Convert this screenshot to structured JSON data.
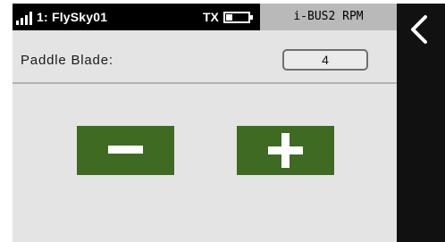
{
  "status_bar": {
    "model_name": "1: FlySky01",
    "tx_label": "TX",
    "signal_icon": "signal-strength-icon",
    "battery_icon": "battery-icon",
    "battery_level": 0.3
  },
  "header": {
    "title": "i-BUS2 RPM"
  },
  "parameter": {
    "label": "Paddle Blade:",
    "value": "4"
  },
  "controls": {
    "decrease_icon": "minus-icon",
    "increase_icon": "plus-icon"
  },
  "navigation": {
    "back_icon": "chevron-left-icon"
  },
  "colors": {
    "button_green": "#3f6a22",
    "screen_background": "#e4e4e4",
    "status_bar": "#000000",
    "title_background": "#b9b9b9"
  }
}
